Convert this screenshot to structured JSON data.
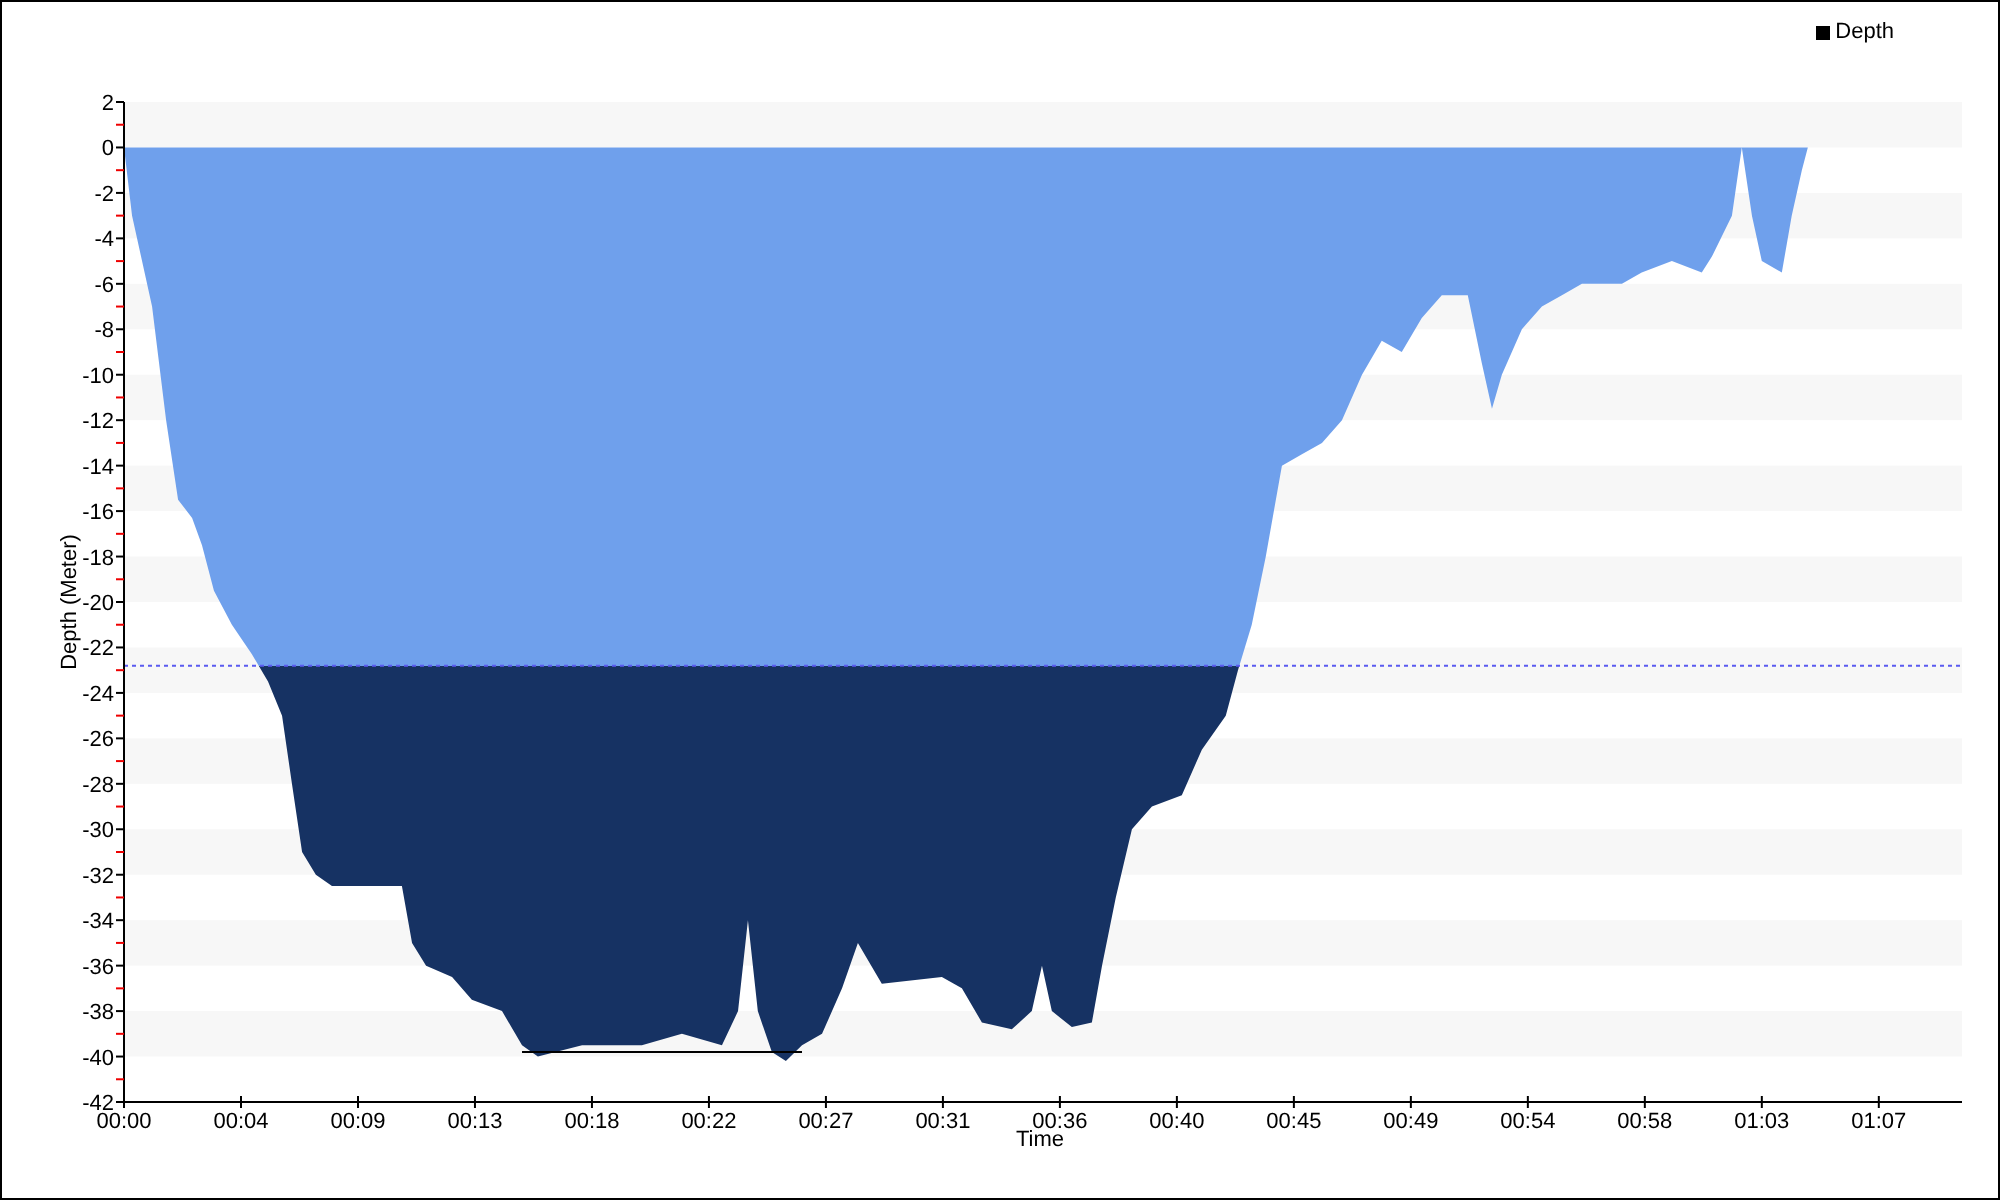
{
  "chart_data": {
    "type": "area",
    "xlabel": "Time",
    "ylabel": "Depth (Meter)",
    "x": [
      0,
      0.31,
      1.08,
      1.62,
      2.08,
      2.62,
      3.0,
      3.46,
      4.15,
      4.92,
      5.54,
      6.08,
      6.46,
      6.85,
      7.38,
      8.0,
      9.15,
      10.69,
      11.08,
      11.62,
      12.62,
      13.38,
      14.54,
      15.31,
      15.92,
      17.62,
      19.92,
      21.46,
      23.0,
      23.62,
      24.0,
      24.38,
      24.92,
      25.46,
      26.08,
      26.85,
      27.62,
      28.23,
      29.15,
      31.46,
      32.23,
      33.0,
      34.15,
      34.92,
      35.31,
      35.69,
      36.46,
      37.23,
      37.62,
      38.15,
      38.77,
      39.54,
      40.69,
      41.46,
      42.38,
      42.85,
      43.38,
      43.92,
      44.54,
      45.31,
      46.08,
      46.85,
      47.62,
      48.38,
      49.15,
      49.92,
      50.69,
      51.69,
      52.23,
      52.62,
      53.0,
      53.77,
      54.54,
      55.31,
      56.08,
      57.62,
      58.38,
      59.54,
      60.69,
      61.08,
      61.85,
      62.23,
      62.62,
      63.0,
      63.77,
      64.15,
      64.54,
      64.77
    ],
    "series": [
      {
        "name": "Depth",
        "color": "#6fa0ec",
        "values": [
          0,
          -3,
          -7,
          -12,
          -15.5,
          -16.3,
          -17.5,
          -19.5,
          -21,
          -22.3,
          -23.5,
          -25,
          -28,
          -31,
          -32,
          -32.5,
          -32.5,
          -32.5,
          -35,
          -36,
          -36.5,
          -37.5,
          -38,
          -39.5,
          -40,
          -39.5,
          -39.5,
          -39,
          -39.5,
          -38,
          -34,
          -38,
          -39.8,
          -40.2,
          -39.5,
          -39,
          -37,
          -35,
          -36.8,
          -36.5,
          -37,
          -38.5,
          -38.8,
          -38,
          -36,
          -38,
          -38.7,
          -38.5,
          -36,
          -33,
          -30,
          -29,
          -28.5,
          -26.5,
          -25,
          -23,
          -21,
          -18,
          -14,
          -13.5,
          -13,
          -12,
          -10,
          -8.5,
          -9,
          -7.5,
          -6.5,
          -6.5,
          -9.5,
          -11.5,
          -10,
          -8,
          -7,
          -6.5,
          -6,
          -6,
          -5.5,
          -5,
          -5.5,
          -4.8,
          -3,
          0,
          -3,
          -5,
          -5.5,
          -3,
          -1,
          0
        ]
      }
    ],
    "xlim": [
      0,
      70.7
    ],
    "ylim": [
      -42,
      2
    ],
    "xticks": [
      {
        "value": 0,
        "label": "00:00"
      },
      {
        "value": 4.5,
        "label": "00:04"
      },
      {
        "value": 9,
        "label": "00:09"
      },
      {
        "value": 13.5,
        "label": "00:13"
      },
      {
        "value": 18,
        "label": "00:18"
      },
      {
        "value": 22.5,
        "label": "00:22"
      },
      {
        "value": 27,
        "label": "00:27"
      },
      {
        "value": 31.5,
        "label": "00:31"
      },
      {
        "value": 36,
        "label": "00:36"
      },
      {
        "value": 40.5,
        "label": "00:40"
      },
      {
        "value": 45,
        "label": "00:45"
      },
      {
        "value": 49.5,
        "label": "00:49"
      },
      {
        "value": 54,
        "label": "00:54"
      },
      {
        "value": 58.5,
        "label": "00:58"
      },
      {
        "value": 63,
        "label": "01:03"
      },
      {
        "value": 67.5,
        "label": "01:07"
      }
    ],
    "yticks": [
      2,
      0,
      -2,
      -4,
      -6,
      -8,
      -10,
      -12,
      -14,
      -16,
      -18,
      -20,
      -22,
      -24,
      -26,
      -28,
      -30,
      -32,
      -34,
      -36,
      -38,
      -40,
      -42
    ],
    "ref_lines": [
      {
        "axis": "y",
        "value": -22.8
      }
    ]
  }
}
